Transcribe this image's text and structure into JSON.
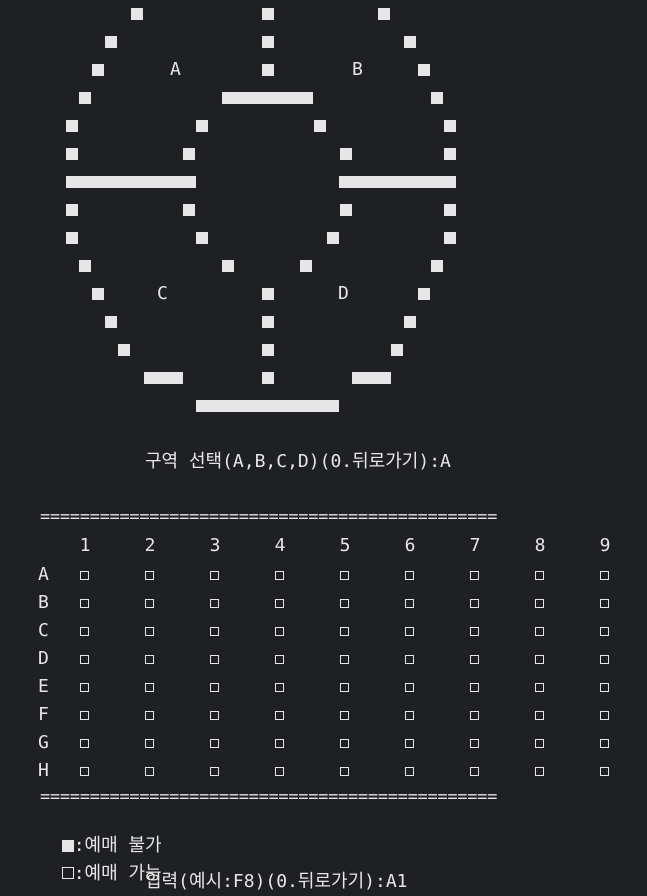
{
  "map": {
    "section_labels": [
      "A",
      "B",
      "C",
      "D"
    ]
  },
  "prompts": {
    "section_select": "구역 선택(A,B,C,D)(0.뒤로가기):A",
    "seat_input": "입력(예시:F8)(0.뒤로가기):A1"
  },
  "grid": {
    "separator": "==============================================",
    "columns": [
      "1",
      "2",
      "3",
      "4",
      "5",
      "6",
      "7",
      "8",
      "9"
    ],
    "rows": [
      "A",
      "B",
      "C",
      "D",
      "E",
      "F",
      "G",
      "H"
    ],
    "seat_status": "available"
  },
  "legend": {
    "unavailable_text": ":예매 불가",
    "available_text": ":예매 가능"
  }
}
